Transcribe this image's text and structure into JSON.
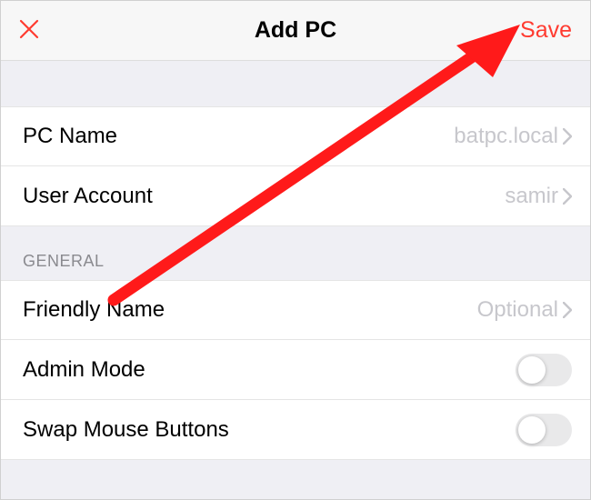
{
  "header": {
    "close_label": "✕",
    "title": "Add PC",
    "save_label": "Save"
  },
  "rows": {
    "pc_name_label": "PC Name",
    "pc_name_value": "batpc.local",
    "user_account_label": "User Account",
    "user_account_value": "samir"
  },
  "section": {
    "general_label": "GENERAL"
  },
  "general": {
    "friendly_name_label": "Friendly Name",
    "friendly_name_value": "Optional",
    "admin_mode_label": "Admin Mode",
    "swap_mouse_label": "Swap Mouse Buttons"
  }
}
